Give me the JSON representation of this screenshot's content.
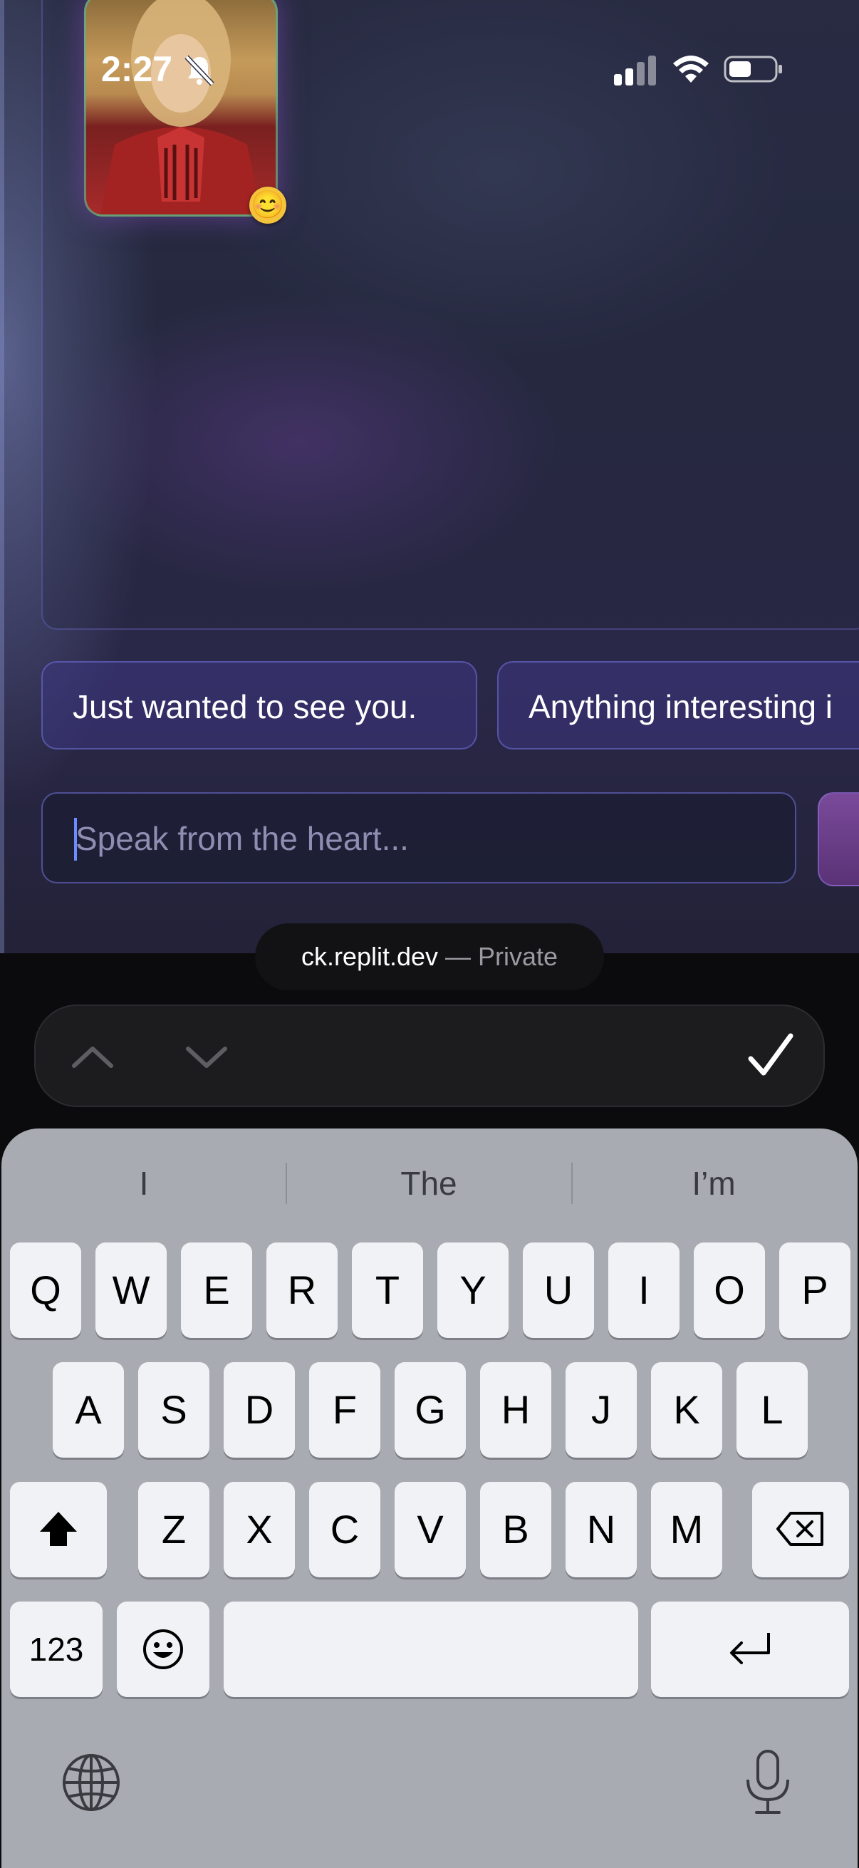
{
  "status_bar": {
    "time": "2:27",
    "icons": [
      "bell-slash-icon",
      "cellular-signal-icon",
      "wifi-icon",
      "battery-icon"
    ]
  },
  "chat": {
    "avatar_badge": "😊",
    "suggestions": [
      "Just wanted to see you.",
      "Anything interesting i"
    ],
    "input": {
      "placeholder": "Speak from the heart...",
      "value": ""
    }
  },
  "browser": {
    "url_domain": "ck.replit.dev",
    "url_suffix": " — Private"
  },
  "form_accessory": {
    "icons": [
      "chevron-up-icon",
      "chevron-down-icon",
      "checkmark-icon"
    ]
  },
  "keyboard": {
    "predictions": [
      "I",
      "The",
      "I’m"
    ],
    "row1": [
      "Q",
      "W",
      "E",
      "R",
      "T",
      "Y",
      "U",
      "I",
      "O",
      "P"
    ],
    "row2": [
      "A",
      "S",
      "D",
      "F",
      "G",
      "H",
      "J",
      "K",
      "L"
    ],
    "row3": [
      "Z",
      "X",
      "C",
      "V",
      "B",
      "N",
      "M"
    ],
    "numbers_key": "123",
    "icons": [
      "shift-icon",
      "delete-icon",
      "emoji-icon",
      "return-icon",
      "globe-icon",
      "microphone-icon"
    ]
  },
  "colors": {
    "accent": "#6d8cff",
    "keyboard_bg": "#a9abb2",
    "key_bg": "#f1f2f5"
  }
}
